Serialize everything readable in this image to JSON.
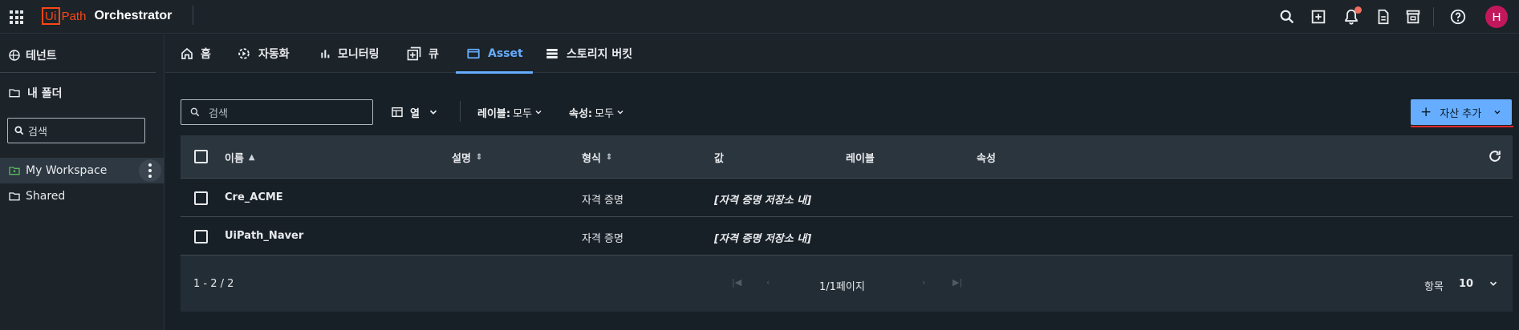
{
  "app": {
    "brand_ui": "Ui",
    "brand_path": "Path",
    "product": "Orchestrator"
  },
  "topbar": {
    "icons": [
      "search-icon",
      "add-box-icon",
      "notifications-icon",
      "document-icon",
      "store-icon",
      "help-icon"
    ],
    "avatar": "H",
    "notification_dot_color": "#f16d5e",
    "avatar_color": "#c2185b"
  },
  "sidebar": {
    "tenant": "테넌트",
    "my_folder": "내 폴더",
    "search_placeholder": "검색",
    "folders": [
      {
        "label": "My Workspace",
        "active": true
      },
      {
        "label": "Shared",
        "active": false
      }
    ]
  },
  "tabs": [
    {
      "label": "홈",
      "icon": "home-icon"
    },
    {
      "label": "자동화",
      "icon": "automation-icon"
    },
    {
      "label": "모니터링",
      "icon": "monitoring-icon"
    },
    {
      "label": "큐",
      "icon": "queue-icon"
    },
    {
      "label": "Asset",
      "icon": "asset-icon",
      "active": true
    },
    {
      "label": "스토리지 버킷",
      "icon": "storage-icon"
    }
  ],
  "toolbar": {
    "search_placeholder": "검색",
    "columns_label": "열",
    "labels_filter": "레이블:",
    "labels_value": "모두",
    "properties_filter": "속성:",
    "properties_value": "모두",
    "add_button": "자산 추가"
  },
  "grid": {
    "headers": [
      "이름",
      "설명",
      "형식",
      "값",
      "레이블",
      "속성"
    ],
    "rows": [
      {
        "name": "Cre_ACME",
        "description": "",
        "type": "자격 증명",
        "value": "[자격 증명 저장소 내]",
        "labels": "",
        "properties": ""
      },
      {
        "name": "UiPath_Naver",
        "description": "",
        "type": "자격 증명",
        "value": "[자격 증명 저장소 내]",
        "labels": "",
        "properties": ""
      }
    ],
    "range": "1 - 2 / 2",
    "page": "1/1페이지",
    "items_label": "항목",
    "items_per_page": "10"
  },
  "colors": {
    "accent": "#66adff",
    "background": "#182027",
    "brand": "#fa4616"
  }
}
